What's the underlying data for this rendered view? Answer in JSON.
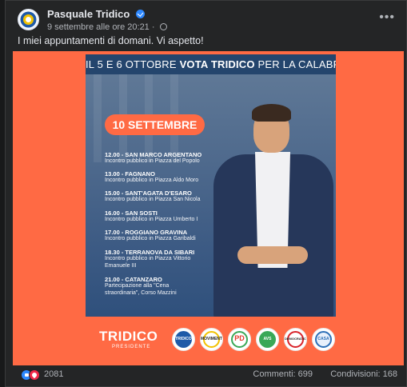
{
  "post": {
    "author": "Pasquale Tridico",
    "timestamp": "9 settembre alle ore 20:21",
    "caption": "I miei appuntamenti di domani. Vi aspetto!"
  },
  "poster": {
    "top_banner_pre": "IL 5 E 6 OTTOBRE ",
    "top_banner_bold": "VOTA TRIDICO",
    "top_banner_post": " PER LA CALABRIA",
    "date": "10 SETTEMBRE",
    "events": [
      {
        "title": "12.00 - SAN MARCO ARGENTANO",
        "desc": "Incontro pubblico in Piazza del Popolo"
      },
      {
        "title": "13.00 - FAGNANO",
        "desc": "Incontro pubblico in Piazza Aldo Moro"
      },
      {
        "title": "15.00 - SANT'AGATA D'ESARO",
        "desc": "Incontro pubblico in Piazza San Nicola"
      },
      {
        "title": "16.00 - SAN SOSTI",
        "desc": "Incontro pubblico in Piazza Umberto I"
      },
      {
        "title": "17.00 - ROGGIANO GRAVINA",
        "desc": "Incontro pubblico in Piazza Garibaldi"
      },
      {
        "title": "18.30 - TERRANOVA DA SIBARI",
        "desc": "Incontro pubblico in Piazza Vittorio",
        "desc2": "Emanuele III"
      },
      {
        "title": "21.00 - CATANZARO",
        "desc": "Partecipazione alla \"Cena",
        "desc2": "straordinaria\", Corso Mazzini"
      }
    ],
    "brand": "TRIDICO",
    "brand_sub": "PRESIDENTE",
    "logos": [
      {
        "label": "TRIDICO",
        "color": "#1e5aa8"
      },
      {
        "label": "MOVIMENTO",
        "color": "#f2c200"
      },
      {
        "label": "PD",
        "color": "#e23b2e"
      },
      {
        "label": "AVS",
        "color": "#39a857"
      },
      {
        "label": "DEMOCRATICI",
        "color": "#d8232a"
      },
      {
        "label": "CASA",
        "color": "#2c6fb7"
      }
    ]
  },
  "stats": {
    "reaction_count": "2081",
    "comments": "Commenti: 699",
    "shares": "Condivisioni: 168"
  },
  "colors": {
    "background": "#18191a",
    "card": "#242526",
    "media_orange": "#ff6a44",
    "poster_blue": "#33567f",
    "accent_blue": "#2d88ff"
  }
}
